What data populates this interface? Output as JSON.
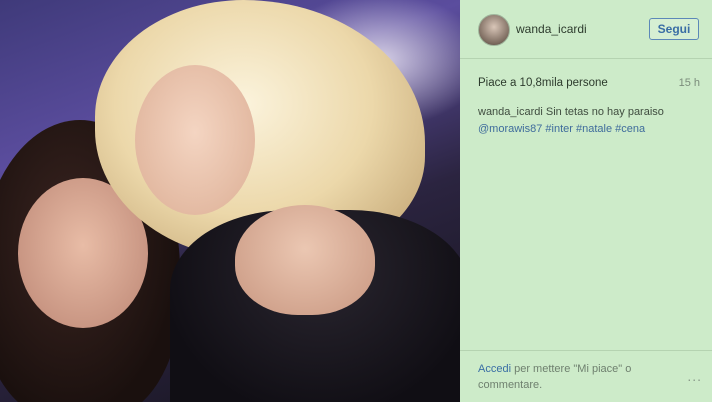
{
  "post": {
    "username": "wanda_icardi",
    "follow_label": "Segui",
    "likes_text": "Piace a 10,8mila persone",
    "time_ago": "15 h",
    "caption": {
      "author": "wanda_icardi",
      "text": " Sin tetas no hay paraiso",
      "mention": "@morawis87",
      "hashtags": [
        "#inter",
        "#natale",
        "#cena"
      ]
    },
    "footer": {
      "login_link": "Accedi",
      "rest": " per mettere \"Mi piace\" o commentare."
    },
    "more_label": "..."
  },
  "icons": {
    "avatar": "avatar-icon",
    "more": "more-options-icon"
  },
  "colors": {
    "panel_bg": "#cdebc9",
    "link": "#3a6ea5",
    "hashtag": "#3f6c9c"
  }
}
